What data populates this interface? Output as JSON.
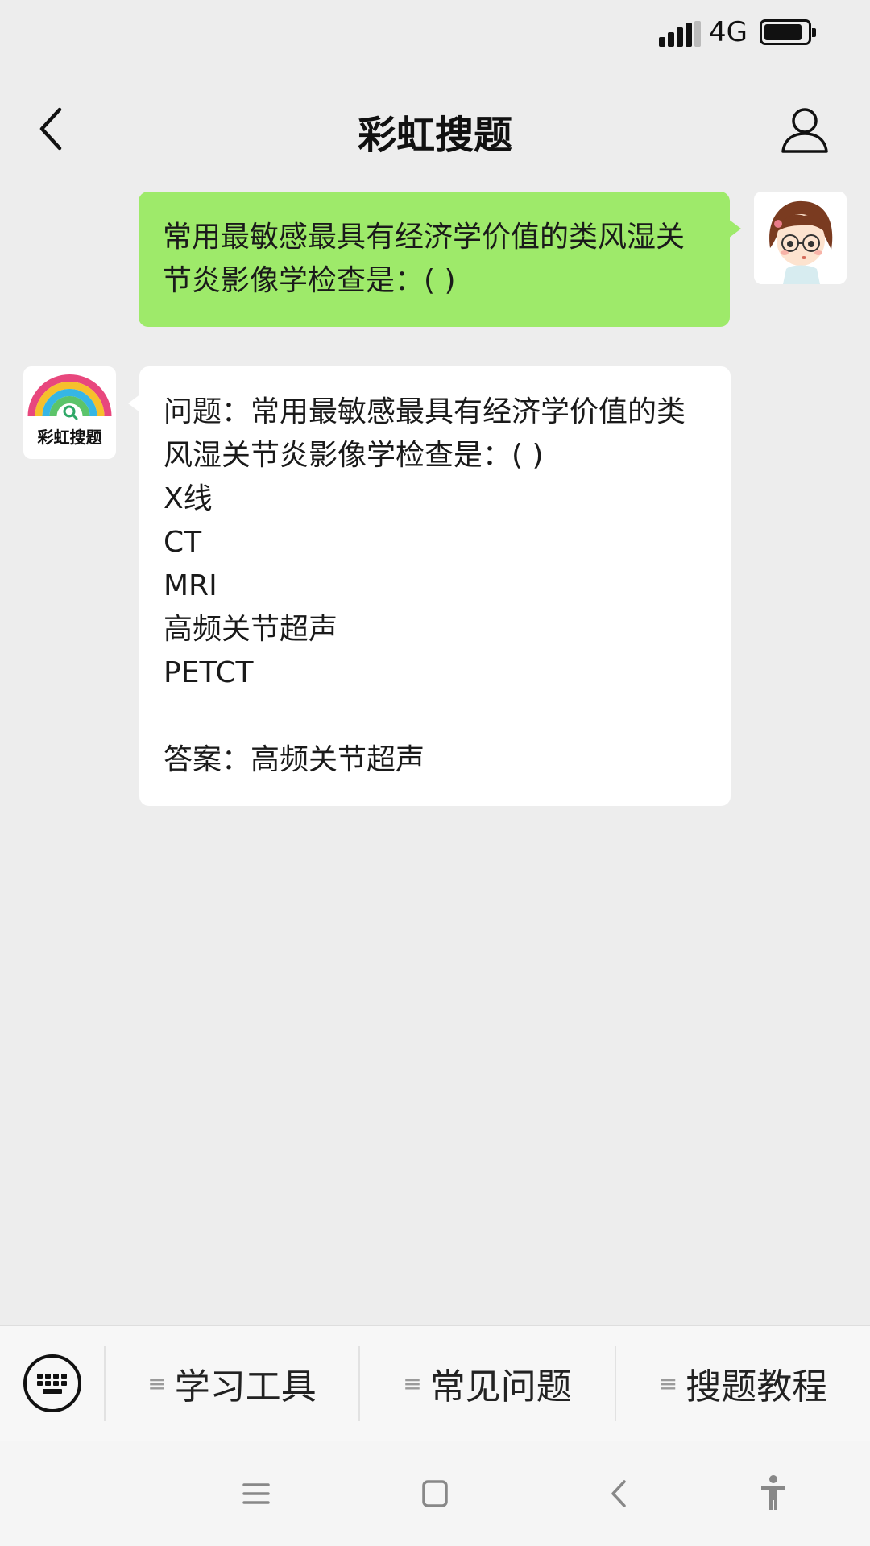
{
  "status_bar": {
    "network": "4G",
    "battery_level": 0.9
  },
  "header": {
    "title": "彩虹搜题",
    "back_icon": "chevron-left-icon",
    "profile_icon": "person-outline-icon"
  },
  "chat": {
    "user_message": "常用最敏感最具有经济学价值的类风湿关节炎影像学检查是：( )",
    "bot": {
      "avatar_label": "彩虹搜题",
      "lines": [
        "问题：常用最敏感最具有经济学价值的类风湿关节炎影像学检查是：( )",
        "X线",
        "CT",
        "MRI",
        "高频关节超声",
        "PETCT",
        "",
        "答案：高频关节超声"
      ]
    }
  },
  "menu": {
    "keyboard_icon": "keyboard-icon",
    "items": [
      {
        "label": "学习工具"
      },
      {
        "label": "常见问题"
      },
      {
        "label": "搜题教程"
      }
    ]
  },
  "nav": [
    "menu-icon",
    "home-square-icon",
    "back-icon",
    "accessibility-icon"
  ],
  "colors": {
    "user_bubble": "#9eea6a",
    "bot_bubble": "#ffffff",
    "background": "#ededed"
  }
}
